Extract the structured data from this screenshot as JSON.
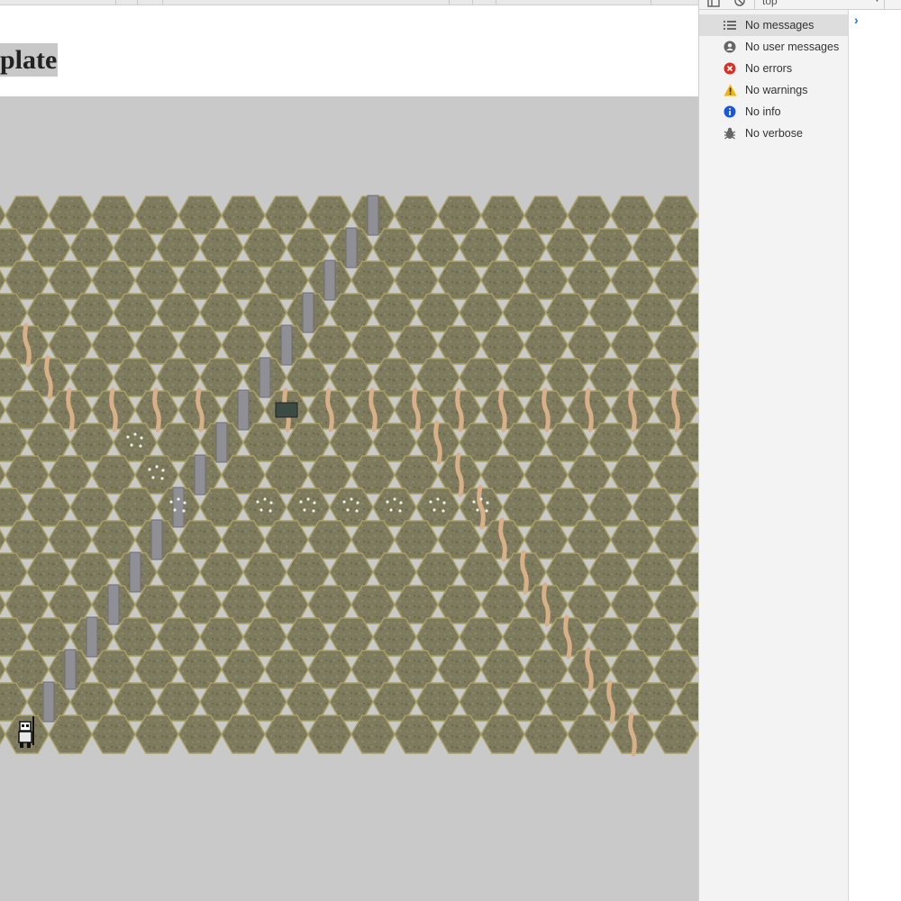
{
  "page": {
    "title": "plate"
  },
  "devtools": {
    "context": "top",
    "filters": [
      {
        "label": "No messages",
        "icon": "list-icon",
        "selected": true
      },
      {
        "label": "No user messages",
        "icon": "user-icon",
        "selected": false
      },
      {
        "label": "No errors",
        "icon": "error-icon",
        "selected": false
      },
      {
        "label": "No warnings",
        "icon": "warning-icon",
        "selected": false
      },
      {
        "label": "No info",
        "icon": "info-icon",
        "selected": false
      },
      {
        "label": "No verbose",
        "icon": "bug-icon",
        "selected": false
      }
    ],
    "prompt": "›"
  },
  "colors": {
    "hex_fill": "#7d7a5e",
    "hex_border": "#a89f63",
    "road": "#8f8f95",
    "river": "#d8b088",
    "background": "#c9c9c9",
    "error": "#d93025",
    "warning": "#f2b600",
    "info": "#1a56db"
  }
}
